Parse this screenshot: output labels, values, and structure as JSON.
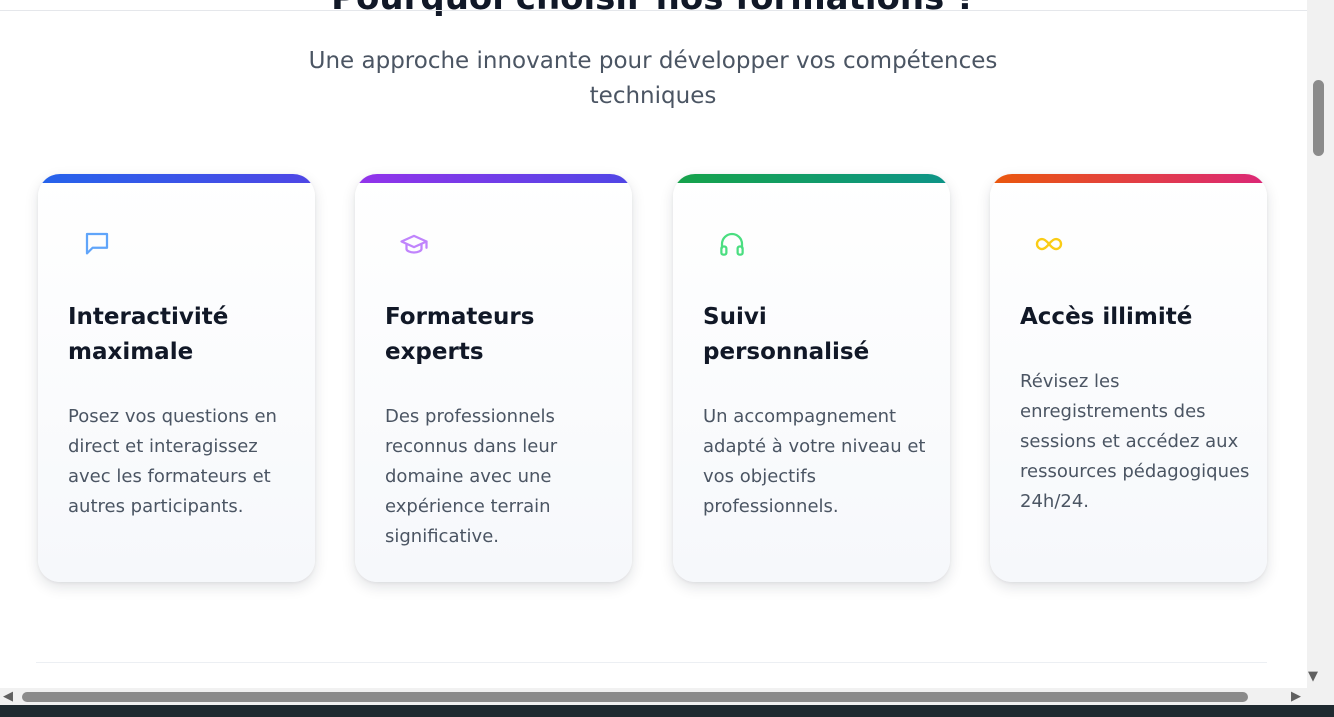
{
  "section": {
    "title": "Pourquoi choisir nos formations ?",
    "subtitle": "Une approche innovante pour développer vos compétences techniques"
  },
  "cards": [
    {
      "icon": "chat-bubble-icon",
      "accent": [
        "#2563eb",
        "#4f46e5"
      ],
      "icon_color": "#60a5fa",
      "title": "Interactivité maximale",
      "text": "Posez vos questions en direct et interagissez avec les formateurs et autres participants."
    },
    {
      "icon": "graduation-cap-icon",
      "accent": [
        "#9333ea",
        "#4f46e5"
      ],
      "icon_color": "#c084fc",
      "title": "Formateurs experts",
      "text": "Des professionnels reconnus dans leur domaine avec une expérience terrain significative."
    },
    {
      "icon": "headphones-icon",
      "accent": [
        "#16a34a",
        "#0d9488"
      ],
      "icon_color": "#4ade80",
      "title": "Suivi personnalisé",
      "text": "Un accompagnement adapté à votre niveau et vos objectifs professionnels."
    },
    {
      "icon": "infinity-icon",
      "accent": [
        "#ea580c",
        "#db2777"
      ],
      "icon_color": "#facc15",
      "title": "Accès illimité",
      "text": "Révisez les enregistrements des sessions et accédez aux ressources pédagogiques 24h/24."
    }
  ],
  "scrollbars": {
    "vertical_position": 0.1,
    "horizontal_position": 0.0
  }
}
